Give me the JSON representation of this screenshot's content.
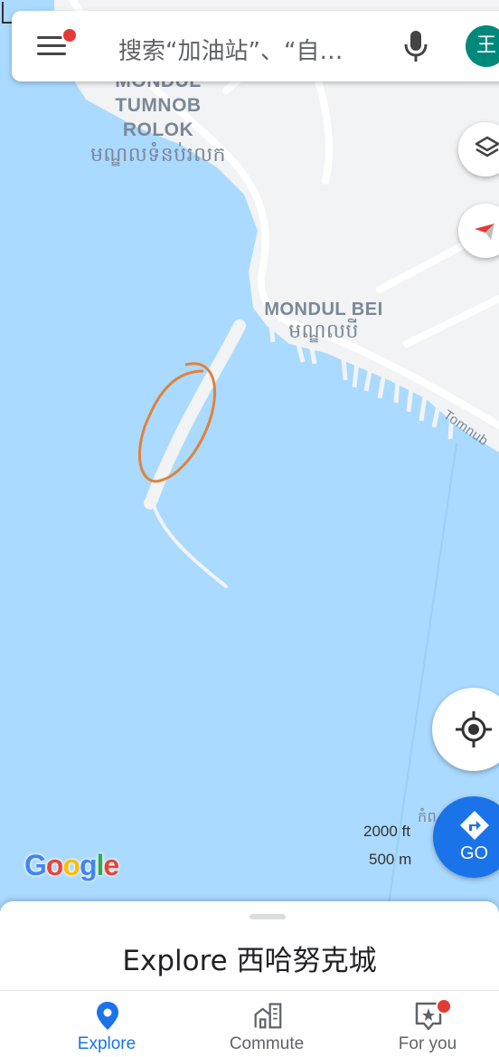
{
  "search": {
    "placeholder": "搜索“加油站”、“自…"
  },
  "avatar": {
    "initial": "王"
  },
  "map": {
    "places": [
      {
        "lines": [
          "MONDUL",
          "TUMNOB",
          "ROLOK"
        ],
        "khmer": "មណ្ឌលទំនប់រលក"
      },
      {
        "lines": [
          "MONDUL BEI"
        ],
        "khmer": "មណ្ឌលបី"
      }
    ],
    "road_label": "Tomnub",
    "edge_label_khmer": "កំព",
    "scale": {
      "feet": "2000 ft",
      "meters": "500 m"
    },
    "logo": [
      "G",
      "o",
      "o",
      "g",
      "l",
      "e"
    ],
    "logo_colors": [
      "#4285f4",
      "#ea4335",
      "#fbbc05",
      "#4285f4",
      "#34a853",
      "#ea4335"
    ]
  },
  "go_button": {
    "label": "GO"
  },
  "sheet": {
    "title": "Explore 西哈努克城"
  },
  "nav": [
    {
      "label": "Explore",
      "active": true
    },
    {
      "label": "Commute",
      "active": false
    },
    {
      "label": "For you",
      "active": false
    }
  ],
  "colors": {
    "water": "#aadaff",
    "land": "#f1f3f4",
    "accent": "#1a73e8",
    "annotation": "#e0823a"
  }
}
